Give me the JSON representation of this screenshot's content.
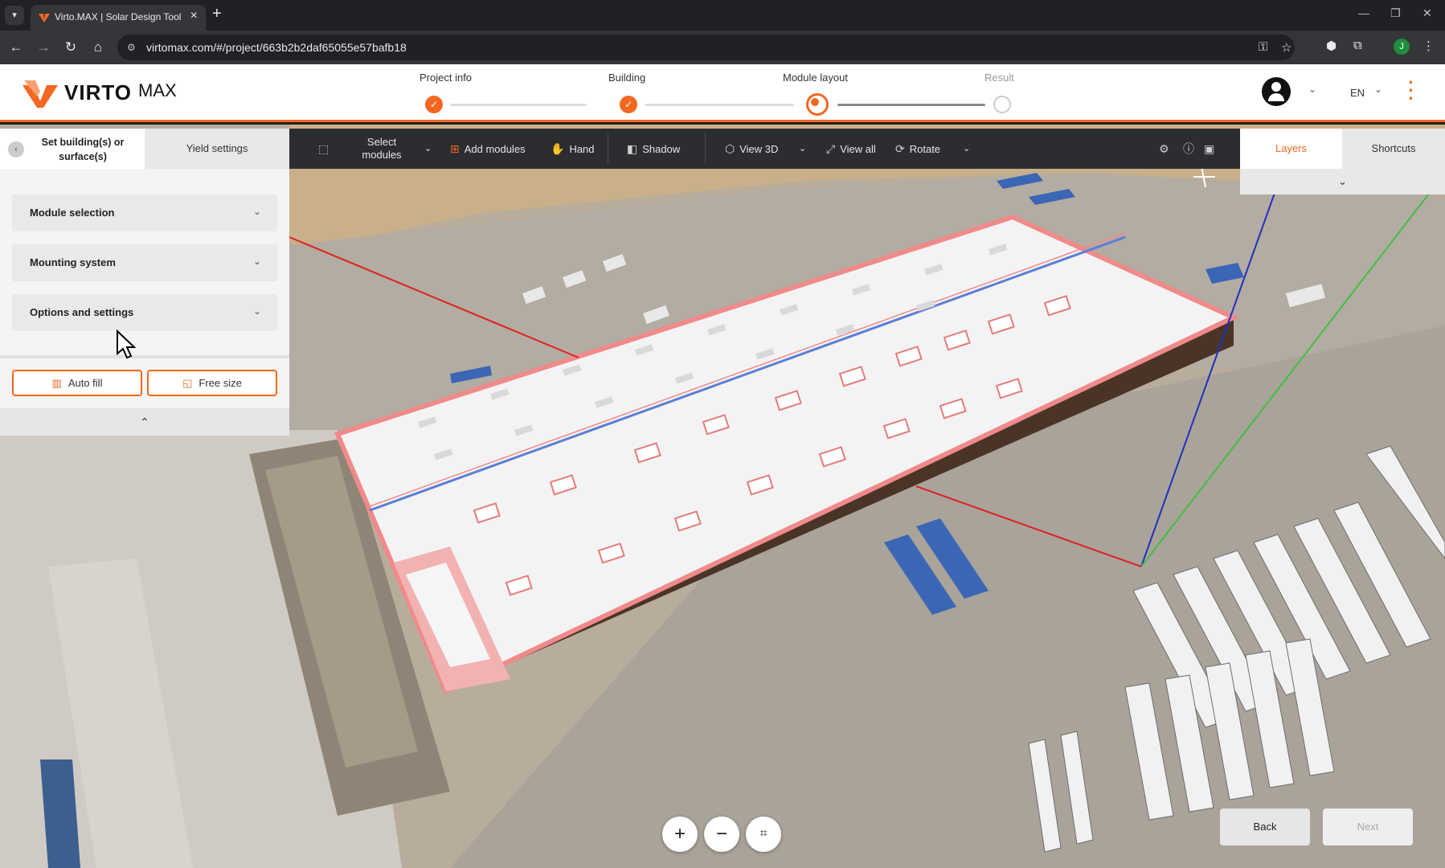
{
  "browser": {
    "tab_title": "Virto.MAX | Solar Design Tool",
    "url": "virtomax.com/#/project/663b2b2daf65055e57bafb18",
    "profile_initial": "J"
  },
  "app": {
    "brand": "VIRTO",
    "brand_suffix": "MAX",
    "accent_color": "#f26722",
    "language": "EN"
  },
  "steps": [
    {
      "label": "Project info",
      "state": "done"
    },
    {
      "label": "Building",
      "state": "done"
    },
    {
      "label": "Module layout",
      "state": "current"
    },
    {
      "label": "Result",
      "state": "todo"
    }
  ],
  "toolbar": {
    "select_modules": "Select modules",
    "add_modules": "Add modules",
    "hand": "Hand",
    "shadow": "Shadow",
    "view_3d": "View 3D",
    "view_all": "View all",
    "rotate": "Rotate"
  },
  "left_panel": {
    "tab_set_building": "Set building(s) or surface(s)",
    "tab_yield": "Yield settings",
    "accordions": [
      {
        "label": "Module selection"
      },
      {
        "label": "Mounting system"
      },
      {
        "label": "Options and settings"
      }
    ],
    "auto_fill": "Auto fill",
    "free_size": "Free size"
  },
  "right_panel": {
    "tab_layers": "Layers",
    "tab_shortcuts": "Shortcuts"
  },
  "footer": {
    "back": "Back",
    "next": "Next"
  }
}
